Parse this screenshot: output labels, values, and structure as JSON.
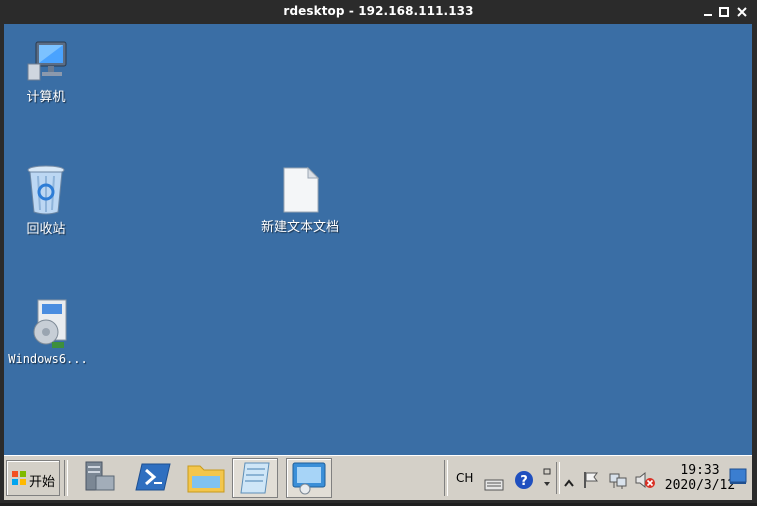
{
  "window": {
    "title": "rdesktop - 192.168.111.133"
  },
  "desktop": {
    "icons": [
      {
        "label": "计算机"
      },
      {
        "label": "回收站"
      },
      {
        "label": "新建文本文档"
      },
      {
        "label": "Windows6..."
      }
    ]
  },
  "taskbar": {
    "start_label": "开始",
    "tray": {
      "lang": "CH",
      "time": "19:33",
      "date": "2020/3/12"
    }
  },
  "colors": {
    "desktop": "#3a6ea5",
    "taskbar": "#d4d0c8",
    "titlebar": "#2b2b2b"
  }
}
